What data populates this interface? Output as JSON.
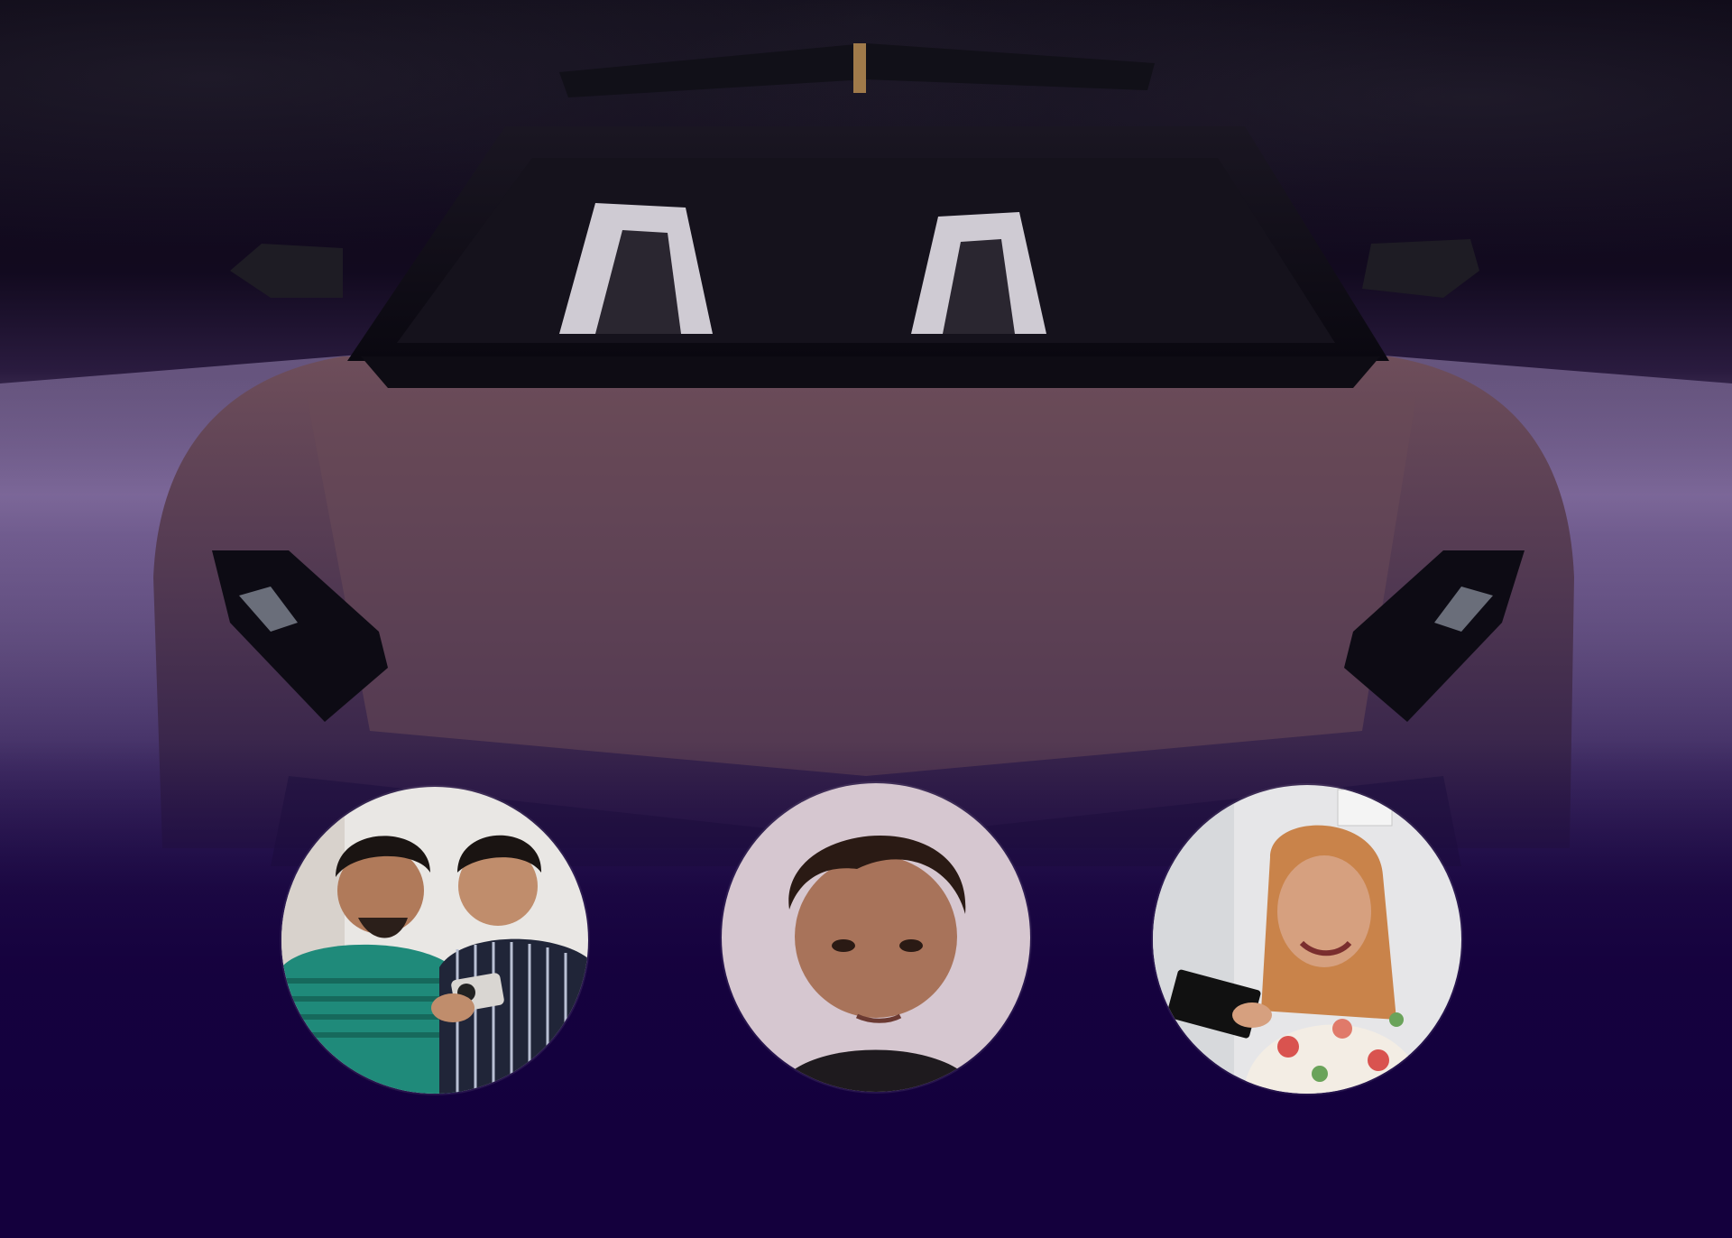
{
  "scene": {
    "subject": "sports-car",
    "car_color": "#5e4150",
    "background_color": "#14003d"
  },
  "creators": [
    {
      "id": "creator-duo",
      "icon": "avatar-two-men-with-phone",
      "accent": "#1f8a7a"
    },
    {
      "id": "creator-teen",
      "icon": "avatar-young-man",
      "accent": "#c9b7c0"
    },
    {
      "id": "creator-woman",
      "icon": "avatar-woman-reading",
      "accent": "#c9834a"
    }
  ]
}
